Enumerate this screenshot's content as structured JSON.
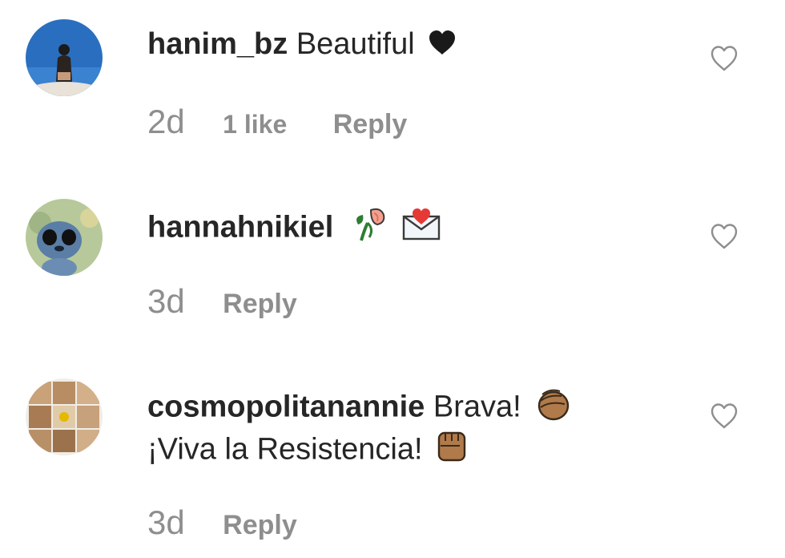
{
  "comments": [
    {
      "username": "hanim_bz",
      "text": "Beautiful",
      "emoji": "black-heart",
      "time": "2d",
      "likes": "1 like",
      "reply_label": "Reply"
    },
    {
      "username": "hannahnikiel",
      "text": "",
      "emoji": "rose-and-love-letter",
      "time": "3d",
      "likes": "",
      "reply_label": "Reply"
    },
    {
      "username": "cosmopolitanannie",
      "text": "Brava!",
      "text_line2": "¡Viva la Resistencia!",
      "emoji": "clapping-hands",
      "emoji_line2": "raised-fist",
      "time": "3d",
      "likes": "",
      "reply_label": "Reply"
    }
  ],
  "colors": {
    "text": "#262626",
    "muted": "#8e8e8e",
    "heart_outline": "#8e8e8e"
  }
}
